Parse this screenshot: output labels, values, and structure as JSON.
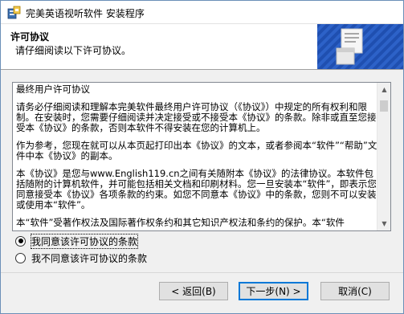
{
  "window": {
    "title": "完美英语视听软件 安装程序"
  },
  "header": {
    "title": "许可协议",
    "subtitle": "请仔细阅读以下许可协议。"
  },
  "license": {
    "paragraphs": [
      "最终用户许可协议",
      "请务必仔细阅读和理解本完美软件最终用户许可协议（《协议》）中规定的所有权利和限制。在安装时，您需要仔细阅读并决定接受或不接受本《协议》的条款。除非或直至您接受本《协议》的条款，否则本软件不得安装在您的计算机上。",
      "作为参考，您现在就可以从本页起打印出本《协议》的文本，或者参阅本“软件”“帮助”文件中本《协议》的副本。",
      "本《协议》是您与www.English119.cn之间有关随附本《协议》的法律协议。本软件包括随附的计算机软件，并可能包括相关文档和印刷材料。您一旦安装本“软件”，即表示您同意接受本《协议》各项条款的约束。如您不同意本《协议》中的条款，您则不可以安装或使用本“软件”。",
      "本“软件”受著作权法及国际著作权条约和其它知识产权法和条约的保护。本“软件"
    ]
  },
  "options": {
    "accept": "我同意该许可协议的条款",
    "decline": "我不同意该许可协议的条款",
    "selected": "accept"
  },
  "buttons": {
    "back": "< 返回(B)",
    "next": "下一步(N) >",
    "cancel": "取消(C)"
  }
}
